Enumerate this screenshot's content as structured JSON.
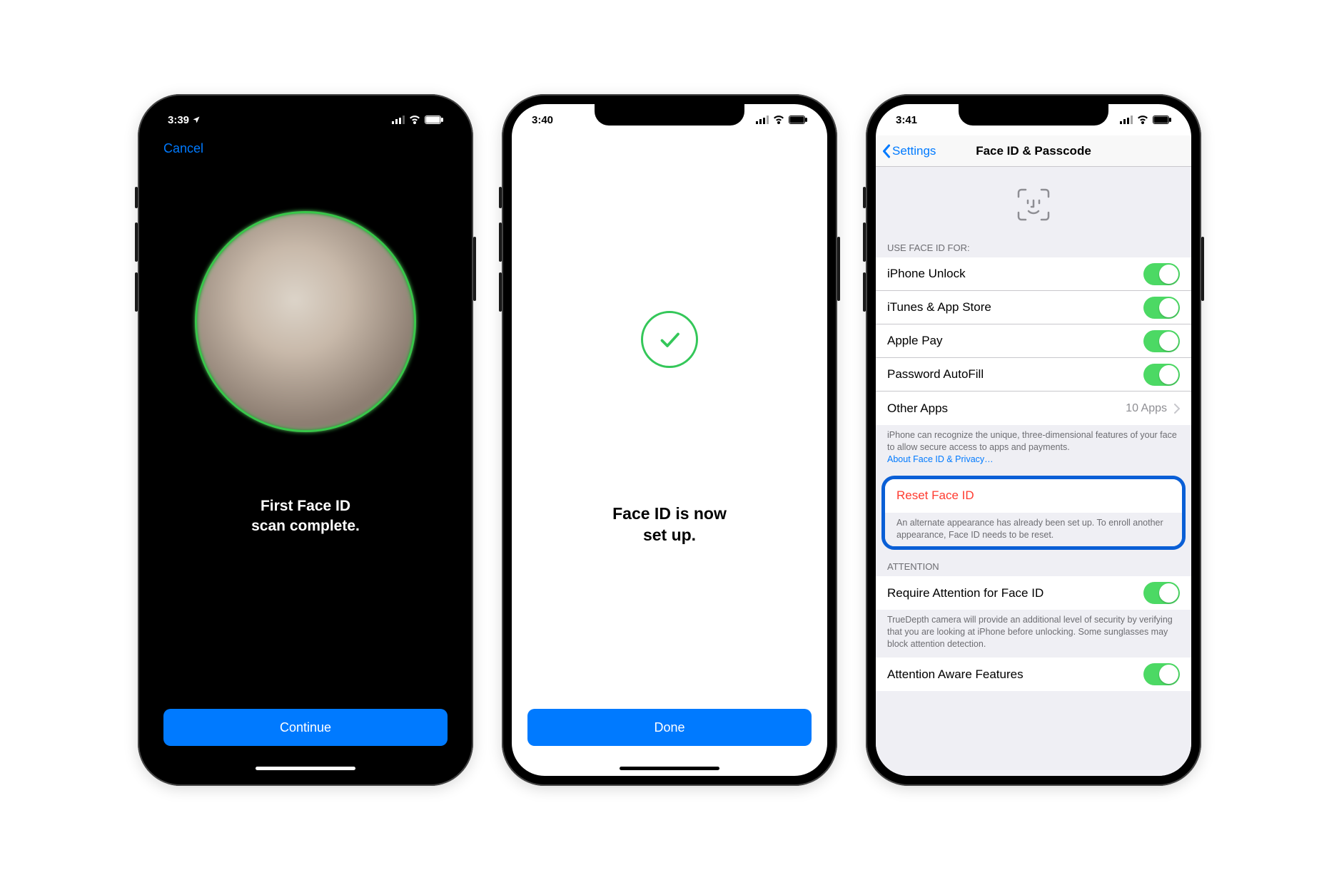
{
  "screen1": {
    "time": "3:39",
    "cancel": "Cancel",
    "message_l1": "First Face ID",
    "message_l2": "scan complete.",
    "button": "Continue"
  },
  "screen2": {
    "time": "3:40",
    "message_l1": "Face ID is now",
    "message_l2": "set up.",
    "button": "Done"
  },
  "screen3": {
    "time": "3:41",
    "back": "Settings",
    "title": "Face ID & Passcode",
    "header_useFor": "USE FACE ID FOR:",
    "rows": {
      "iphoneUnlock": "iPhone Unlock",
      "itunes": "iTunes & App Store",
      "applePay": "Apple Pay",
      "autofill": "Password AutoFill",
      "otherApps": "Other Apps",
      "otherAppsCount": "10 Apps"
    },
    "footer_recognize": "iPhone can recognize the unique, three-dimensional features of your face to allow secure access to apps and payments.",
    "footer_privacyLink": "About Face ID & Privacy…",
    "reset": "Reset Face ID",
    "reset_footer": "An alternate appearance has already been set up. To enroll another appearance, Face ID needs to be reset.",
    "header_attention": "ATTENTION",
    "requireAttention": "Require Attention for Face ID",
    "requireAttention_footer": "TrueDepth camera will provide an additional level of security by verifying that you are looking at iPhone before unlocking. Some sunglasses may block attention detection.",
    "attentionAware": "Attention Aware Features"
  }
}
